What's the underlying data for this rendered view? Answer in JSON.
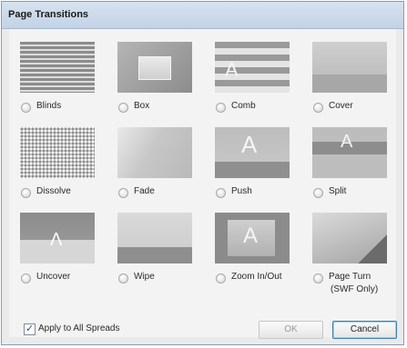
{
  "dialog": {
    "title": "Page Transitions"
  },
  "transitions": [
    {
      "label": "Blinds"
    },
    {
      "label": "Box"
    },
    {
      "label": "Comb"
    },
    {
      "label": "Cover"
    },
    {
      "label": "Dissolve"
    },
    {
      "label": "Fade"
    },
    {
      "label": "Push"
    },
    {
      "label": "Split"
    },
    {
      "label": "Uncover"
    },
    {
      "label": "Wipe"
    },
    {
      "label": "Zoom In/Out"
    },
    {
      "label": "Page Turn",
      "sublabel": "(SWF Only)"
    }
  ],
  "footer": {
    "apply_all_label": "Apply to All Spreads",
    "apply_all_checked": true,
    "ok_label": "OK",
    "cancel_label": "Cancel"
  }
}
